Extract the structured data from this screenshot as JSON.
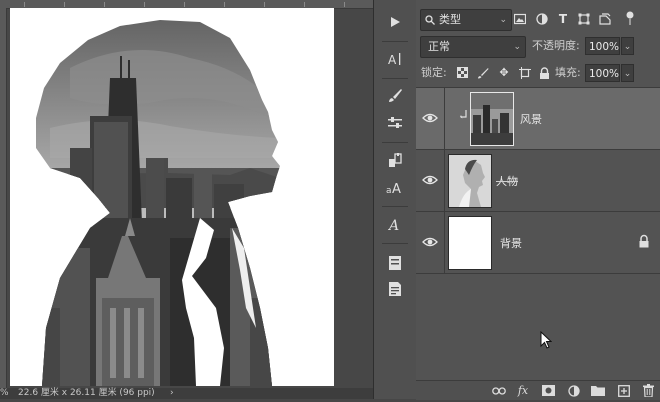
{
  "status_bar": {
    "zoom_fragment": "%",
    "document_size": "22.6 厘米 x 26.11 厘米 (96 ppi)",
    "expand_arrow": "›"
  },
  "tool_strip": {
    "buttons": [
      {
        "name": "play-action",
        "icon": "▶"
      },
      {
        "name": "character-paragraph",
        "icon": "A|"
      },
      {
        "name": "brush-settings",
        "icon": "brush"
      },
      {
        "name": "adjustments",
        "icon": "sliders"
      },
      {
        "name": "clone-source",
        "icon": "stamp"
      },
      {
        "name": "character-styles",
        "icon": "ᴀA"
      },
      {
        "name": "glyphs",
        "icon": "𝒜"
      },
      {
        "name": "notes",
        "icon": "note"
      },
      {
        "name": "properties",
        "icon": "doc"
      }
    ]
  },
  "layers_panel": {
    "filter": {
      "kind_label": "类型",
      "search_icon": "search-icon",
      "filter_icons": [
        "image-filter-icon",
        "adjustment-filter-icon",
        "type-filter-icon",
        "shape-filter-icon",
        "smart-object-filter-icon",
        "filter-toggle-icon"
      ]
    },
    "blend_mode": "正常",
    "opacity_label": "不透明度:",
    "opacity_value": "100%",
    "lock_label": "锁定:",
    "lock_icons": [
      "lock-transparent-icon",
      "lock-pixels-icon",
      "lock-position-icon",
      "lock-artboard-icon",
      "lock-all-icon"
    ],
    "fill_label": "填充:",
    "fill_value": "100%",
    "layers": [
      {
        "name": "风景",
        "visible": true,
        "selected": true,
        "clipped": true,
        "locked": false,
        "thumb": "cityscape"
      },
      {
        "name": "人物",
        "visible": true,
        "selected": false,
        "clipped": false,
        "locked": false,
        "thumb": "portrait"
      },
      {
        "name": "背景",
        "visible": true,
        "selected": false,
        "clipped": false,
        "locked": true,
        "thumb": "white"
      }
    ],
    "footer_icons": [
      "link-layers-icon",
      "fx-icon",
      "add-mask-icon",
      "adjustment-layer-icon",
      "new-group-icon",
      "new-layer-icon",
      "delete-layer-icon"
    ]
  },
  "colors": {
    "panel_bg": "#535353",
    "selected_row": "#6a6a6a",
    "canvas_bg": "#474747"
  }
}
